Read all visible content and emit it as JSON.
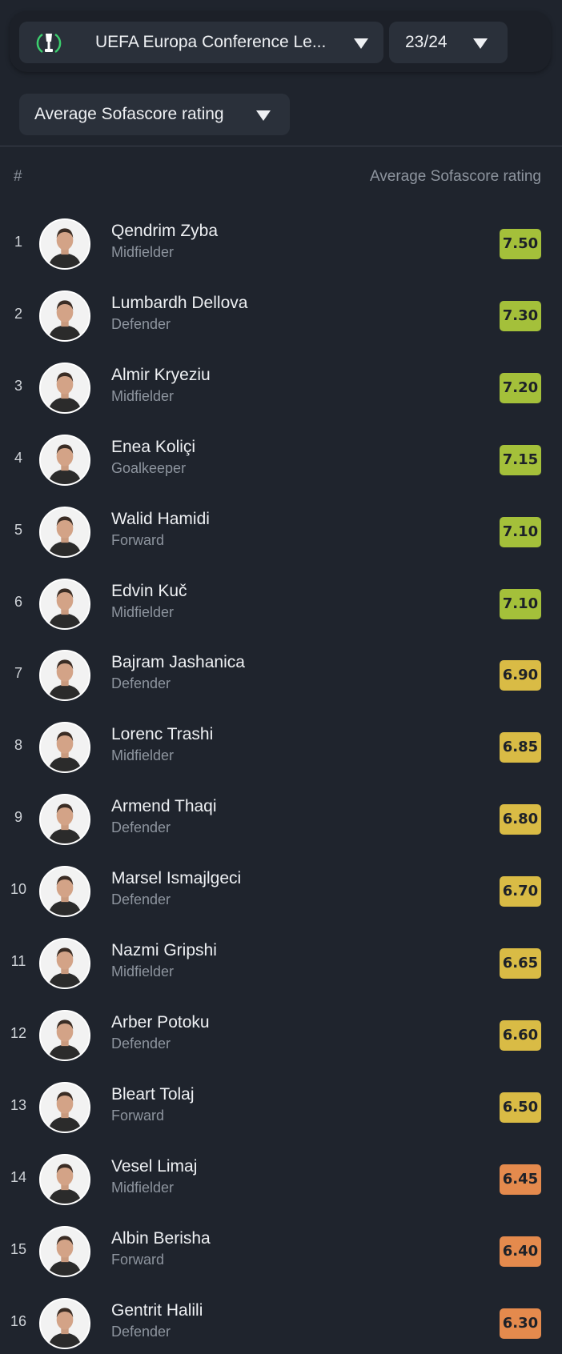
{
  "competition": {
    "name": "UEFA Europa Conference Le...",
    "logo_icon": "conference-league-trophy-icon"
  },
  "season": {
    "label": "23/24"
  },
  "metric": {
    "label": "Average Sofascore rating"
  },
  "table": {
    "rank_header": "#",
    "rating_header": "Average Sofascore rating"
  },
  "rating_colors": {
    "green": "#a4c03a",
    "yellow": "#d9bb45",
    "orange": "#e48a4d"
  },
  "players": [
    {
      "rank": "1",
      "name": "Qendrim Zyba",
      "position": "Midfielder",
      "rating": "7.50",
      "color": "#a4c03a"
    },
    {
      "rank": "2",
      "name": "Lumbardh Dellova",
      "position": "Defender",
      "rating": "7.30",
      "color": "#a4c03a"
    },
    {
      "rank": "3",
      "name": "Almir Kryeziu",
      "position": "Midfielder",
      "rating": "7.20",
      "color": "#a4c03a"
    },
    {
      "rank": "4",
      "name": "Enea Koliçi",
      "position": "Goalkeeper",
      "rating": "7.15",
      "color": "#a4c03a"
    },
    {
      "rank": "5",
      "name": "Walid Hamidi",
      "position": "Forward",
      "rating": "7.10",
      "color": "#a4c03a"
    },
    {
      "rank": "6",
      "name": "Edvin Kuč",
      "position": "Midfielder",
      "rating": "7.10",
      "color": "#a4c03a"
    },
    {
      "rank": "7",
      "name": "Bajram Jashanica",
      "position": "Defender",
      "rating": "6.90",
      "color": "#d9bb45"
    },
    {
      "rank": "8",
      "name": "Lorenc Trashi",
      "position": "Midfielder",
      "rating": "6.85",
      "color": "#d9bb45"
    },
    {
      "rank": "9",
      "name": "Armend Thaqi",
      "position": "Defender",
      "rating": "6.80",
      "color": "#d9bb45"
    },
    {
      "rank": "10",
      "name": "Marsel Ismajlgeci",
      "position": "Defender",
      "rating": "6.70",
      "color": "#d9bb45"
    },
    {
      "rank": "11",
      "name": "Nazmi Gripshi",
      "position": "Midfielder",
      "rating": "6.65",
      "color": "#d9bb45"
    },
    {
      "rank": "12",
      "name": "Arber Potoku",
      "position": "Defender",
      "rating": "6.60",
      "color": "#d9bb45"
    },
    {
      "rank": "13",
      "name": "Bleart Tolaj",
      "position": "Forward",
      "rating": "6.50",
      "color": "#d9bb45"
    },
    {
      "rank": "14",
      "name": "Vesel Limaj",
      "position": "Midfielder",
      "rating": "6.45",
      "color": "#e48a4d"
    },
    {
      "rank": "15",
      "name": "Albin Berisha",
      "position": "Forward",
      "rating": "6.40",
      "color": "#e48a4d"
    },
    {
      "rank": "16",
      "name": "Gentrit Halili",
      "position": "Defender",
      "rating": "6.30",
      "color": "#e48a4d"
    }
  ]
}
